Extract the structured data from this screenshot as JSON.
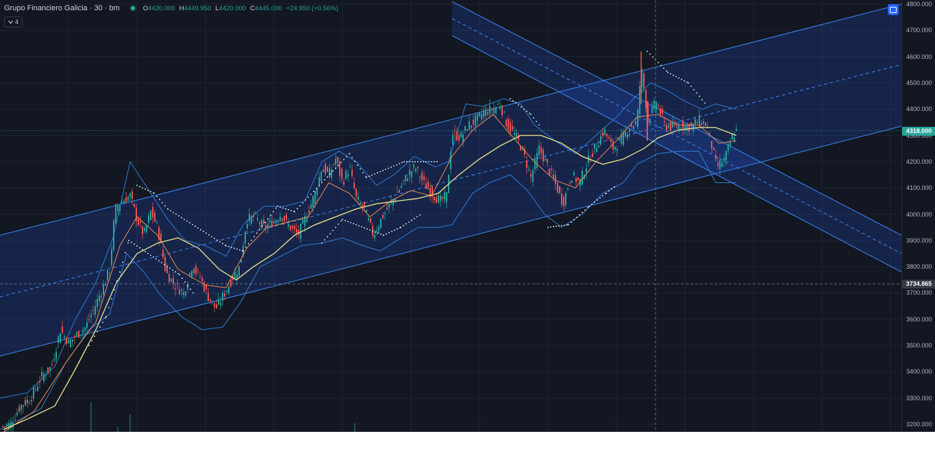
{
  "legend": {
    "symbol": "Grupo Financiero Galicia · 30 · bm",
    "open_key": "O",
    "open": "4420.000",
    "high_key": "H",
    "high": "4449.950",
    "low_key": "L",
    "low": "4420.000",
    "close_key": "C",
    "close": "4445.000",
    "change": "+24.950 (+0.56%)"
  },
  "indicator_toggle": {
    "icon": "chevron-down-icon",
    "count": "4"
  },
  "settings_button": {
    "icon": "settings-icon"
  },
  "colors": {
    "background": "#131722",
    "grid": "#1f2330",
    "up": "#26a69a",
    "down": "#ef5350",
    "channel": "#2962ff",
    "channel_line": "#3d8bfd",
    "bollinger": "#2f7ed8",
    "ma_long": "#e6df8a",
    "ma_short": "#f08c4a",
    "sar": "#ffffff"
  },
  "price_axis": {
    "ticks": [
      "4800.000",
      "4700.000",
      "4600.000",
      "4500.000",
      "4400.000",
      "4300.000",
      "4200.000",
      "4100.000",
      "4000.000",
      "3900.000",
      "3800.000",
      "3700.000",
      "3600.000",
      "3500.000",
      "3400.000",
      "3300.000",
      "3200.000"
    ],
    "last_price_label": "4318.000",
    "crosshair_label": "3734.865"
  },
  "chart_data": {
    "type": "candlestick",
    "title": "Grupo Financiero Galicia · 30 · bm",
    "ylim": [
      3180,
      4810
    ],
    "last_price": 4318,
    "crosshair_price": 3734.865,
    "price_path": [
      [
        0,
        3190
      ],
      [
        15,
        3200
      ],
      [
        30,
        3270
      ],
      [
        45,
        3300
      ],
      [
        60,
        3380
      ],
      [
        75,
        3420
      ],
      [
        88,
        3560
      ],
      [
        100,
        3510
      ],
      [
        112,
        3540
      ],
      [
        125,
        3570
      ],
      [
        137,
        3640
      ],
      [
        150,
        3720
      ],
      [
        160,
        3790
      ],
      [
        168,
        4020
      ],
      [
        178,
        4050
      ],
      [
        190,
        4070
      ],
      [
        200,
        3980
      ],
      [
        210,
        3920
      ],
      [
        220,
        4010
      ],
      [
        230,
        3950
      ],
      [
        242,
        3780
      ],
      [
        255,
        3730
      ],
      [
        268,
        3700
      ],
      [
        280,
        3800
      ],
      [
        292,
        3760
      ],
      [
        303,
        3690
      ],
      [
        315,
        3640
      ],
      [
        328,
        3700
      ],
      [
        340,
        3760
      ],
      [
        350,
        3800
      ],
      [
        360,
        3980
      ],
      [
        372,
        3990
      ],
      [
        385,
        3950
      ],
      [
        398,
        3970
      ],
      [
        410,
        4000
      ],
      [
        420,
        3960
      ],
      [
        435,
        3920
      ],
      [
        448,
        4000
      ],
      [
        460,
        4080
      ],
      [
        470,
        4180
      ],
      [
        480,
        4150
      ],
      [
        490,
        4210
      ],
      [
        500,
        4120
      ],
      [
        510,
        4180
      ],
      [
        520,
        4060
      ],
      [
        532,
        4020
      ],
      [
        545,
        3920
      ],
      [
        558,
        3990
      ],
      [
        570,
        4040
      ],
      [
        582,
        4090
      ],
      [
        595,
        4150
      ],
      [
        606,
        4180
      ],
      [
        618,
        4120
      ],
      [
        630,
        4080
      ],
      [
        642,
        4050
      ],
      [
        652,
        4070
      ],
      [
        660,
        4310
      ],
      [
        672,
        4290
      ],
      [
        684,
        4340
      ],
      [
        696,
        4360
      ],
      [
        706,
        4390
      ],
      [
        718,
        4400
      ],
      [
        730,
        4420
      ],
      [
        740,
        4340
      ],
      [
        752,
        4300
      ],
      [
        762,
        4250
      ],
      [
        775,
        4140
      ],
      [
        787,
        4250
      ],
      [
        798,
        4190
      ],
      [
        810,
        4120
      ],
      [
        822,
        4040
      ],
      [
        834,
        4150
      ],
      [
        846,
        4120
      ],
      [
        858,
        4200
      ],
      [
        870,
        4260
      ],
      [
        882,
        4320
      ],
      [
        894,
        4250
      ],
      [
        906,
        4280
      ],
      [
        918,
        4330
      ],
      [
        930,
        4350
      ],
      [
        936,
        4560
      ],
      [
        946,
        4360
      ],
      [
        958,
        4430
      ],
      [
        970,
        4340
      ],
      [
        984,
        4330
      ],
      [
        996,
        4340
      ],
      [
        1008,
        4330
      ],
      [
        1020,
        4360
      ],
      [
        1032,
        4340
      ],
      [
        1046,
        4180
      ],
      [
        1058,
        4210
      ],
      [
        1068,
        4290
      ],
      [
        1075,
        4318
      ]
    ],
    "ma_long": [
      [
        5,
        3180
      ],
      [
        40,
        3220
      ],
      [
        80,
        3270
      ],
      [
        110,
        3410
      ],
      [
        140,
        3560
      ],
      [
        170,
        3740
      ],
      [
        200,
        3850
      ],
      [
        230,
        3890
      ],
      [
        260,
        3910
      ],
      [
        290,
        3870
      ],
      [
        320,
        3790
      ],
      [
        345,
        3750
      ],
      [
        370,
        3800
      ],
      [
        400,
        3850
      ],
      [
        430,
        3920
      ],
      [
        460,
        3960
      ],
      [
        490,
        3990
      ],
      [
        520,
        4020
      ],
      [
        550,
        4040
      ],
      [
        580,
        4050
      ],
      [
        610,
        4060
      ],
      [
        640,
        4080
      ],
      [
        670,
        4150
      ],
      [
        700,
        4210
      ],
      [
        730,
        4260
      ],
      [
        760,
        4300
      ],
      [
        790,
        4300
      ],
      [
        820,
        4270
      ],
      [
        850,
        4220
      ],
      [
        880,
        4190
      ],
      [
        910,
        4210
      ],
      [
        940,
        4250
      ],
      [
        960,
        4290
      ],
      [
        990,
        4320
      ],
      [
        1020,
        4330
      ],
      [
        1045,
        4330
      ],
      [
        1075,
        4300
      ]
    ],
    "ma_short": [
      [
        5,
        3170
      ],
      [
        50,
        3250
      ],
      [
        100,
        3450
      ],
      [
        140,
        3590
      ],
      [
        175,
        3880
      ],
      [
        200,
        3990
      ],
      [
        230,
        3920
      ],
      [
        260,
        3790
      ],
      [
        300,
        3730
      ],
      [
        330,
        3720
      ],
      [
        360,
        3870
      ],
      [
        390,
        3950
      ],
      [
        420,
        3970
      ],
      [
        450,
        3990
      ],
      [
        480,
        4120
      ],
      [
        510,
        4080
      ],
      [
        540,
        3990
      ],
      [
        570,
        4050
      ],
      [
        600,
        4090
      ],
      [
        630,
        4070
      ],
      [
        660,
        4220
      ],
      [
        690,
        4320
      ],
      [
        720,
        4380
      ],
      [
        750,
        4290
      ],
      [
        780,
        4200
      ],
      [
        810,
        4130
      ],
      [
        840,
        4100
      ],
      [
        870,
        4200
      ],
      [
        900,
        4280
      ],
      [
        930,
        4370
      ],
      [
        960,
        4380
      ],
      [
        990,
        4340
      ],
      [
        1020,
        4340
      ],
      [
        1050,
        4270
      ],
      [
        1075,
        4280
      ]
    ],
    "bollinger_upper": [
      [
        0,
        3300
      ],
      [
        40,
        3320
      ],
      [
        80,
        3420
      ],
      [
        110,
        3600
      ],
      [
        140,
        3740
      ],
      [
        165,
        3910
      ],
      [
        190,
        4200
      ],
      [
        215,
        4100
      ],
      [
        245,
        3980
      ],
      [
        270,
        3900
      ],
      [
        300,
        3880
      ],
      [
        330,
        3840
      ],
      [
        355,
        3960
      ],
      [
        385,
        4030
      ],
      [
        415,
        4030
      ],
      [
        445,
        4050
      ],
      [
        470,
        4200
      ],
      [
        495,
        4240
      ],
      [
        520,
        4200
      ],
      [
        550,
        4110
      ],
      [
        575,
        4150
      ],
      [
        605,
        4220
      ],
      [
        635,
        4180
      ],
      [
        655,
        4200
      ],
      [
        680,
        4420
      ],
      [
        705,
        4410
      ],
      [
        735,
        4440
      ],
      [
        760,
        4420
      ],
      [
        780,
        4340
      ],
      [
        810,
        4280
      ],
      [
        840,
        4230
      ],
      [
        870,
        4300
      ],
      [
        900,
        4370
      ],
      [
        925,
        4440
      ],
      [
        950,
        4500
      ],
      [
        975,
        4470
      ],
      [
        1000,
        4430
      ],
      [
        1025,
        4400
      ],
      [
        1045,
        4420
      ],
      [
        1075,
        4400
      ]
    ],
    "bollinger_lower": [
      [
        0,
        3180
      ],
      [
        30,
        3220
      ],
      [
        60,
        3260
      ],
      [
        95,
        3430
      ],
      [
        130,
        3560
      ],
      [
        160,
        3620
      ],
      [
        185,
        3850
      ],
      [
        210,
        3780
      ],
      [
        235,
        3690
      ],
      [
        265,
        3610
      ],
      [
        295,
        3560
      ],
      [
        325,
        3570
      ],
      [
        350,
        3660
      ],
      [
        380,
        3800
      ],
      [
        410,
        3840
      ],
      [
        440,
        3880
      ],
      [
        470,
        3890
      ],
      [
        500,
        3910
      ],
      [
        530,
        3880
      ],
      [
        555,
        3860
      ],
      [
        580,
        3900
      ],
      [
        610,
        3950
      ],
      [
        640,
        3950
      ],
      [
        660,
        3960
      ],
      [
        690,
        4080
      ],
      [
        715,
        4120
      ],
      [
        745,
        4150
      ],
      [
        770,
        4090
      ],
      [
        795,
        4000
      ],
      [
        820,
        3950
      ],
      [
        850,
        4000
      ],
      [
        880,
        4080
      ],
      [
        910,
        4120
      ],
      [
        930,
        4190
      ],
      [
        960,
        4230
      ],
      [
        990,
        4240
      ],
      [
        1020,
        4240
      ],
      [
        1045,
        4120
      ],
      [
        1075,
        4120
      ]
    ],
    "sar_up": [
      [
        130,
        3500
      ],
      [
        155,
        3610
      ],
      [
        175,
        3780
      ],
      [
        188,
        3900
      ],
      [
        262,
        3770
      ],
      [
        285,
        3690
      ],
      [
        470,
        3890
      ],
      [
        500,
        3980
      ],
      [
        560,
        3920
      ],
      [
        585,
        3950
      ],
      [
        615,
        4000
      ],
      [
        800,
        3950
      ],
      [
        830,
        3960
      ],
      [
        860,
        4030
      ],
      [
        885,
        4080
      ],
      [
        900,
        4110
      ],
      [
        1065,
        4150
      ]
    ],
    "sar_down": [
      [
        200,
        4110
      ],
      [
        225,
        4080
      ],
      [
        245,
        4020
      ],
      [
        330,
        3880
      ],
      [
        355,
        3860
      ],
      [
        405,
        4030
      ],
      [
        430,
        4010
      ],
      [
        510,
        4230
      ],
      [
        535,
        4140
      ],
      [
        590,
        4200
      ],
      [
        640,
        4200
      ],
      [
        745,
        4440
      ],
      [
        775,
        4380
      ],
      [
        790,
        4330
      ],
      [
        945,
        4620
      ],
      [
        975,
        4540
      ],
      [
        1005,
        4500
      ],
      [
        1030,
        4420
      ]
    ],
    "ascending_channel": {
      "x": [
        0,
        1316
      ],
      "upper": [
        3920,
        4800
      ],
      "lower": [
        3460,
        4335
      ],
      "mid": [
        3685,
        4570
      ]
    },
    "descending_channel": {
      "x": [
        660,
        1316
      ],
      "upper": [
        4810,
        3920
      ],
      "lower": [
        4680,
        3780
      ],
      "mid": [
        4745,
        3850
      ]
    },
    "volume_spikes": [
      [
        133,
        0.17
      ],
      [
        190,
        0.1
      ],
      [
        172,
        0.03
      ],
      [
        518,
        0.05
      ]
    ]
  }
}
